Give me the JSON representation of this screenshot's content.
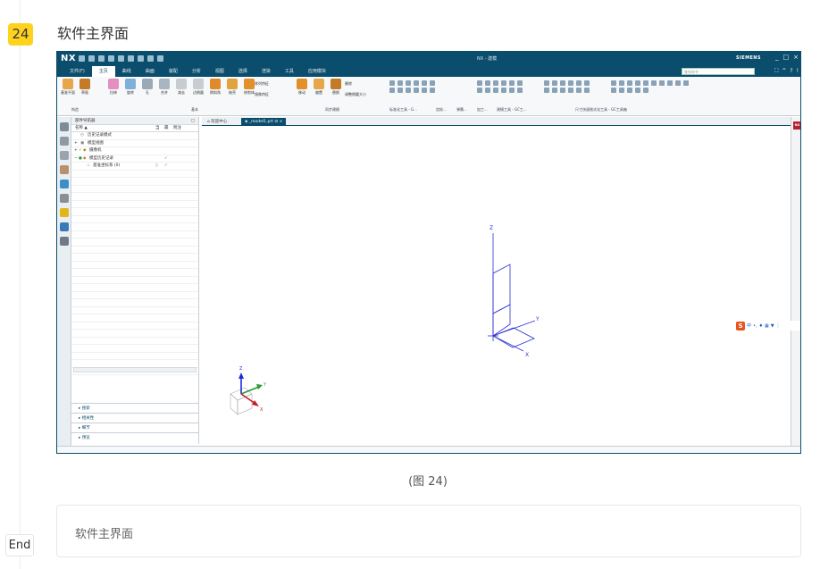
{
  "step": {
    "number": "24",
    "title": "软件主界面",
    "end_label": "End"
  },
  "caption": "(图 24)",
  "note": {
    "text": "软件主界面"
  },
  "nx": {
    "logo": "NX",
    "window_title": "NX - 建模",
    "brand": "SIEMENS",
    "window_controls": [
      "_",
      "□",
      "×"
    ],
    "menu": [
      "文件(F)",
      "主页",
      "曲线",
      "曲面",
      "装配",
      "分析",
      "视图",
      "选择",
      "渲染",
      "工具",
      "应用模块"
    ],
    "active_menu": "主页",
    "search_placeholder": "查找命令",
    "menu_right": [
      "⛶",
      "^",
      "?",
      "!"
    ],
    "ribbon": {
      "datum": [
        {
          "label": "基准平面"
        },
        {
          "label": "草图"
        }
      ],
      "features": [
        {
          "label": "拉伸"
        },
        {
          "label": "旋转"
        },
        {
          "label": "孔"
        },
        {
          "label": "合并"
        },
        {
          "label": "减去"
        },
        {
          "label": "边倒圆"
        },
        {
          "label": "倒斜角"
        },
        {
          "label": "抽壳"
        },
        {
          "label": "修剪体"
        }
      ],
      "features_extra": [
        "阵列特征",
        "镜像特征"
      ],
      "sync": [
        {
          "label": "移动"
        },
        {
          "label": "偏置"
        },
        {
          "label": "替换"
        }
      ],
      "sync_extra": [
        "删除",
        "调整倒圆大小"
      ],
      "group_labels": [
        "构造",
        "基本",
        "同步建模",
        "标准化工具 - G...",
        "齿轮...",
        "弹簧...",
        "加工...",
        "建模工具 - GC工...",
        "尺寸快速格式化工具 - GC工具箱"
      ]
    },
    "navigator": {
      "title": "部件导航器",
      "col_name": "名称 ▲",
      "col_a": "当",
      "col_b": "最",
      "col_c": "附注",
      "rows": [
        {
          "label": "历史记录模式"
        },
        {
          "label": "模型视图"
        },
        {
          "label": "摄像机"
        },
        {
          "label": "模型历史记录"
        },
        {
          "label": "基准坐标系 (0)"
        }
      ],
      "sections": [
        "搜索",
        "相关性",
        "细节",
        "预览"
      ]
    },
    "tabs": [
      "欢迎中心",
      "_model1.prt ⊡ ×"
    ],
    "axis_labels": {
      "x": "X",
      "y": "Y",
      "z": "Z"
    },
    "nx_badge": "NX",
    "ime": {
      "logo": "S",
      "lang": "中"
    }
  }
}
